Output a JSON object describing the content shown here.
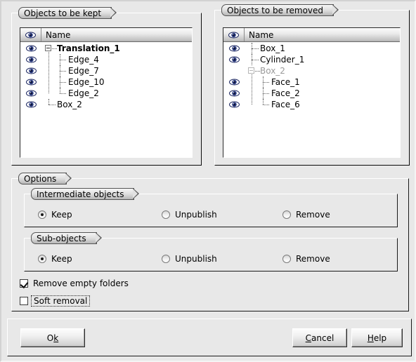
{
  "dialog": {
    "kept_group_title": "Objects to be kept",
    "removed_group_title": "Objects to be removed",
    "options_group_title": "Options"
  },
  "tree_header": {
    "eye_icon": "eye-icon",
    "name_column": "Name"
  },
  "kept_tree": {
    "rows": [
      {
        "label": "Translation_1",
        "eye": true,
        "bold": true,
        "dim": false,
        "depth": 0,
        "expander": "minus"
      },
      {
        "label": "Edge_4",
        "eye": true,
        "bold": false,
        "dim": false,
        "depth": 1,
        "expander": "none"
      },
      {
        "label": "Edge_7",
        "eye": true,
        "bold": false,
        "dim": false,
        "depth": 1,
        "expander": "none"
      },
      {
        "label": "Edge_10",
        "eye": true,
        "bold": false,
        "dim": false,
        "depth": 1,
        "expander": "none"
      },
      {
        "label": "Edge_2",
        "eye": true,
        "bold": false,
        "dim": false,
        "depth": 1,
        "expander": "none"
      },
      {
        "label": "Box_2",
        "eye": true,
        "bold": false,
        "dim": false,
        "depth": 0,
        "expander": "none"
      }
    ]
  },
  "removed_tree": {
    "rows": [
      {
        "label": "Box_1",
        "eye": true,
        "bold": false,
        "dim": false,
        "depth": 0,
        "expander": "none"
      },
      {
        "label": "Cylinder_1",
        "eye": true,
        "bold": false,
        "dim": false,
        "depth": 0,
        "expander": "none"
      },
      {
        "label": "Box_2",
        "eye": false,
        "bold": false,
        "dim": true,
        "depth": 0,
        "expander": "minus"
      },
      {
        "label": "Face_1",
        "eye": true,
        "bold": false,
        "dim": false,
        "depth": 1,
        "expander": "none"
      },
      {
        "label": "Face_2",
        "eye": true,
        "bold": false,
        "dim": false,
        "depth": 1,
        "expander": "none"
      },
      {
        "label": "Face_6",
        "eye": true,
        "bold": false,
        "dim": false,
        "depth": 1,
        "expander": "none"
      }
    ]
  },
  "intermediate_objects": {
    "title": "Intermediate objects",
    "options": [
      {
        "label": "Keep",
        "selected": true
      },
      {
        "label": "Unpublish",
        "selected": false
      },
      {
        "label": "Remove",
        "selected": false
      }
    ]
  },
  "sub_objects": {
    "title": "Sub-objects",
    "options": [
      {
        "label": "Keep",
        "selected": true
      },
      {
        "label": "Unpublish",
        "selected": false
      },
      {
        "label": "Remove",
        "selected": false
      }
    ]
  },
  "checkboxes": {
    "remove_empty_folders": {
      "label": "Remove empty folders",
      "checked": true,
      "focused": false
    },
    "soft_removal": {
      "label": "Soft removal",
      "checked": false,
      "focused": true
    }
  },
  "buttons": {
    "ok": {
      "pre": "O",
      "mnemonic": "k",
      "post": ""
    },
    "cancel": {
      "pre": "",
      "mnemonic": "C",
      "post": "ancel"
    },
    "help": {
      "pre": "",
      "mnemonic": "H",
      "post": "elp"
    }
  },
  "colors": {
    "window_bg": "#e8e8e8",
    "tree_bg": "#ffffff",
    "eye_icon": "#2e3f86",
    "disabled_text": "#9a9a9a",
    "title_border": "#555555"
  }
}
